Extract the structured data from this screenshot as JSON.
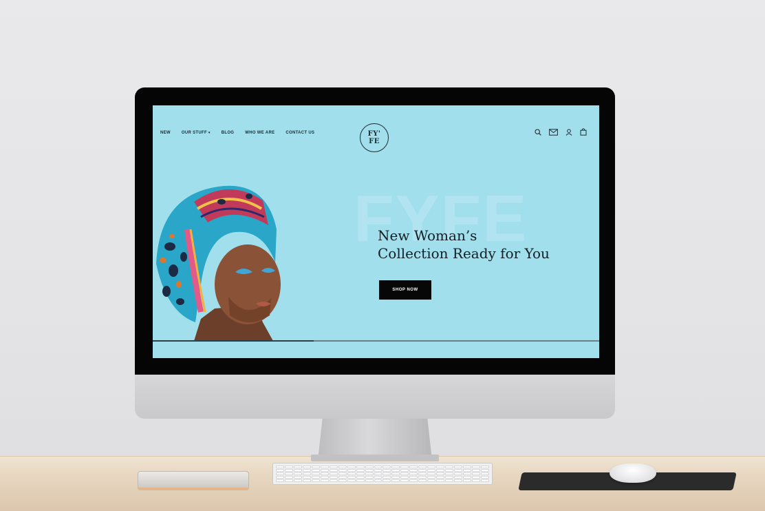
{
  "site": {
    "nav": {
      "items": [
        {
          "label": "NEW"
        },
        {
          "label": "OUR STUFF",
          "has_dropdown": true
        },
        {
          "label": "BLOG"
        },
        {
          "label": "WHO WE ARE"
        },
        {
          "label": "CONTACT US"
        }
      ],
      "dropdown_caret": "▾"
    },
    "logo": {
      "line1": "FY'",
      "line2": "FE"
    },
    "header_icons": [
      "search-icon",
      "mail-icon",
      "user-icon",
      "bag-icon"
    ],
    "hero": {
      "watermark": "FYFE",
      "headline_line1": "New Woman’s",
      "headline_line2": "Collection Ready for You",
      "cta_label": "SHOP NOW",
      "slide_progress": 0.36
    },
    "colors": {
      "background": "#a2dfed",
      "cta": "#070707",
      "text": "#121e24"
    }
  }
}
